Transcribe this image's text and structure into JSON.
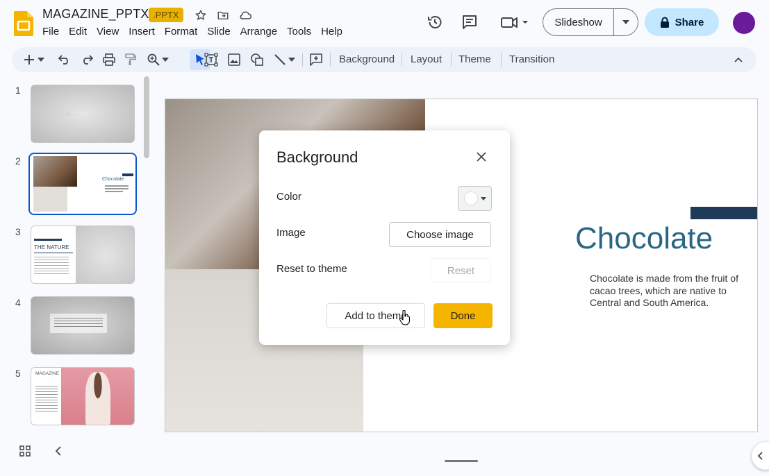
{
  "doc": {
    "title": "MAGAZINE_PPTX",
    "badge": ".PPTX"
  },
  "menu": [
    "File",
    "Edit",
    "View",
    "Insert",
    "Format",
    "Slide",
    "Arrange",
    "Tools",
    "Help"
  ],
  "header": {
    "slideshow_label": "Slideshow",
    "share_label": "Share"
  },
  "toolbar": {
    "background_label": "Background",
    "layout_label": "Layout",
    "theme_label": "Theme",
    "transition_label": "Transition"
  },
  "filmstrip": {
    "slides": [
      {
        "number": "1",
        "text": "Ma..."
      },
      {
        "number": "2",
        "text": "Chocolate"
      },
      {
        "number": "3",
        "text": "THE NATURE"
      },
      {
        "number": "4",
        "text": ""
      },
      {
        "number": "5",
        "text": "MAGAZINE"
      }
    ],
    "selected_index": 2
  },
  "slide": {
    "title": "Chocolate",
    "body": "Chocolate is made from the fruit of cacao trees, which are native to Central and South America."
  },
  "dialog": {
    "title": "Background",
    "color_label": "Color",
    "image_label": "Image",
    "choose_image_label": "Choose image",
    "reset_to_theme_label": "Reset to theme",
    "reset_label": "Reset",
    "add_to_theme_label": "Add to theme",
    "done_label": "Done"
  },
  "colors": {
    "accent_blue": "#0b57d0",
    "share_bg": "#c2e7ff",
    "done_yellow": "#f4b400",
    "badge_yellow": "#e8b100",
    "slide_title": "#2a6685",
    "avatar": "#6a1b9a"
  },
  "icons": {
    "logo": "slides-logo-icon",
    "star": "star-icon",
    "folder": "move-folder-icon",
    "cloud": "cloud-status-icon",
    "history": "history-icon",
    "comments": "comment-icon",
    "meet": "video-call-icon",
    "lock": "lock-icon"
  }
}
